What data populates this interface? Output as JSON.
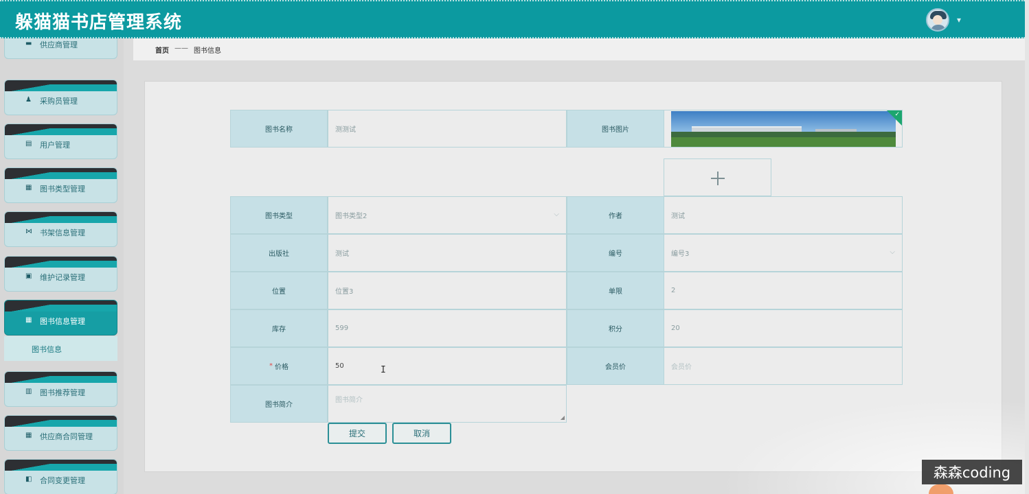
{
  "header": {
    "title": "躲猫猫书店管理系统",
    "avatar_caret": "▾"
  },
  "sidebar": {
    "items": [
      {
        "label": "供应商管理",
        "icon": "card-icon",
        "glyph": "▬"
      },
      {
        "label": "采购员管理",
        "icon": "user-icon",
        "glyph": "♟"
      },
      {
        "label": "用户管理",
        "icon": "clipboard-icon",
        "glyph": "▤"
      },
      {
        "label": "图书类型管理",
        "icon": "grid-icon",
        "glyph": "▦"
      },
      {
        "label": "书架信息管理",
        "icon": "bowtie-icon",
        "glyph": "⋈"
      },
      {
        "label": "维护记录管理",
        "icon": "chart-icon",
        "glyph": "▣"
      },
      {
        "label": "图书信息管理",
        "icon": "grid-icon",
        "glyph": "▦"
      },
      {
        "label": "图书推荐管理",
        "icon": "check-doc-icon",
        "glyph": "▥"
      },
      {
        "label": "供应商合同管理",
        "icon": "grid-icon",
        "glyph": "▦"
      },
      {
        "label": "合同变更管理",
        "icon": "thumb-icon",
        "glyph": "◧"
      }
    ],
    "submenu": {
      "label": "图书信息"
    }
  },
  "breadcrumb": {
    "home": "首页",
    "separator": "——",
    "current": "图书信息"
  },
  "form": {
    "name": {
      "label": "图书名称",
      "value": "测测试"
    },
    "image": {
      "label": "图书图片"
    },
    "type": {
      "label": "图书类型",
      "value": "图书类型2"
    },
    "author": {
      "label": "作者",
      "value": "测试"
    },
    "publisher": {
      "label": "出版社",
      "value": "测试"
    },
    "code": {
      "label": "编号",
      "value": "编号3"
    },
    "position": {
      "label": "位置",
      "value": "位置3"
    },
    "limit": {
      "label": "单限",
      "value": "2"
    },
    "stock": {
      "label": "库存",
      "value": "599"
    },
    "points": {
      "label": "积分",
      "value": "20"
    },
    "price": {
      "required_mark": "*",
      "label": "价格",
      "value": "50"
    },
    "member_price": {
      "label": "会员价",
      "placeholder": "会员价"
    },
    "intro": {
      "label": "图书简介",
      "placeholder": "图书简介"
    },
    "submit_label": "提交",
    "cancel_label": "取消"
  },
  "watermark": "森森coding",
  "colors": {
    "header": "#0c9aa0",
    "active_menu": "#169ea4",
    "label_bg": "#c6e0e6",
    "button_border": "#2b8f96"
  }
}
